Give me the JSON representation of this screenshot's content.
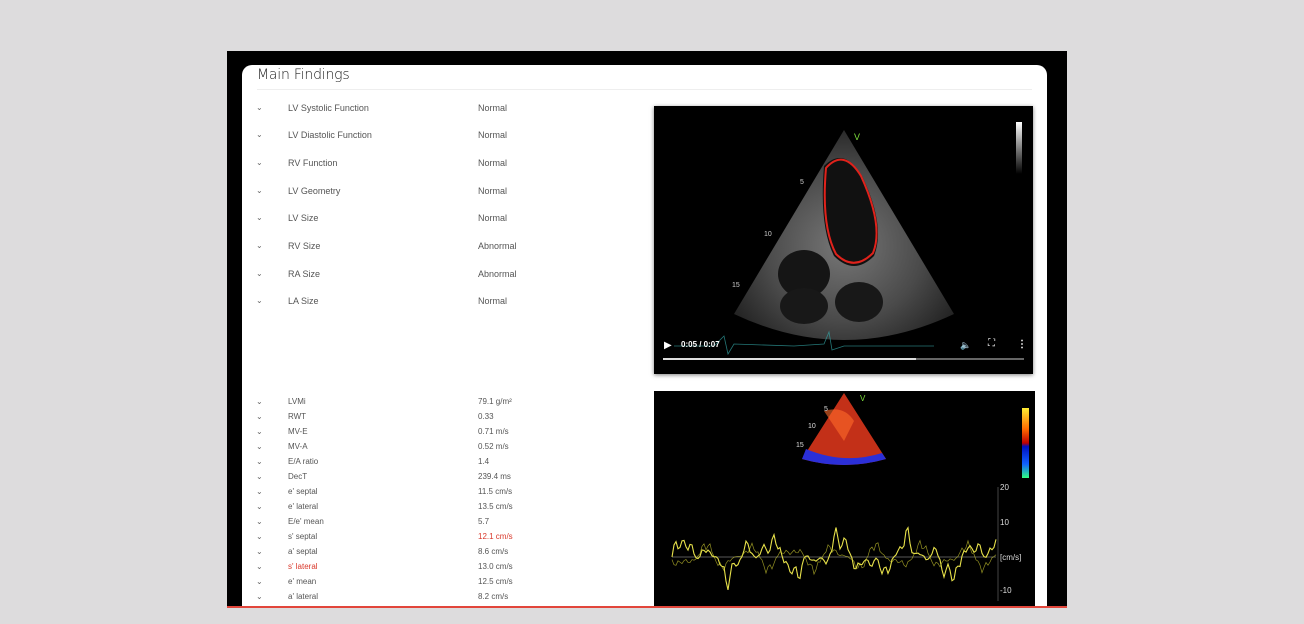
{
  "page": {
    "title": "Main Findings"
  },
  "findings": [
    {
      "label": "LV Systolic Function",
      "value": "Normal"
    },
    {
      "label": "LV Diastolic Function",
      "value": "Normal"
    },
    {
      "label": "RV Function",
      "value": "Normal"
    },
    {
      "label": "LV Geometry",
      "value": "Normal"
    },
    {
      "label": "LV Size",
      "value": "Normal"
    },
    {
      "label": "RV Size",
      "value": "Abnormal"
    },
    {
      "label": "RA Size",
      "value": "Abnormal"
    },
    {
      "label": "LA Size",
      "value": "Normal"
    }
  ],
  "measurements": [
    {
      "label": "LVMi",
      "value": "79.1 g/m²"
    },
    {
      "label": "RWT",
      "value": "0.33"
    },
    {
      "label": "MV-E",
      "value": "0.71 m/s"
    },
    {
      "label": "MV-A",
      "value": "0.52 m/s"
    },
    {
      "label": "E/A ratio",
      "value": "1.4"
    },
    {
      "label": "DecT",
      "value": "239.4 ms"
    },
    {
      "label": "e' septal",
      "value": "11.5 cm/s"
    },
    {
      "label": "e' lateral",
      "value": "13.5 cm/s"
    },
    {
      "label": "E/e' mean",
      "value": "5.7"
    },
    {
      "label": "s' septal",
      "value": "12.1 cm/s"
    },
    {
      "label": "a' septal",
      "value": "8.6 cm/s"
    },
    {
      "label": "s' lateral",
      "value": "13.0 cm/s"
    },
    {
      "label": "e' mean",
      "value": "12.5 cm/s"
    },
    {
      "label": "a' lateral",
      "value": "8.2 cm/s"
    }
  ],
  "video": {
    "time": "0:05 / 0:07",
    "progress": 0.7,
    "depth_marks": [
      "5",
      "10",
      "15"
    ],
    "marker": "V"
  },
  "doppler": {
    "marker": "V",
    "depth_marks": [
      "5",
      "10",
      "15"
    ],
    "scale": [
      "20",
      "10",
      "[cm/s]",
      "-10"
    ]
  },
  "colors": {
    "accent_red": "#d9382b",
    "trace_yellow": "#e8e24a",
    "lv_contour": "#e0221b"
  }
}
